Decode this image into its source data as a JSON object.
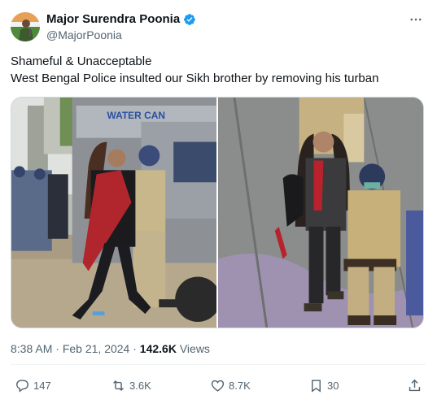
{
  "author": {
    "name": "Major Surendra Poonia",
    "handle": "@MajorPoonia",
    "verified": true
  },
  "tweet": {
    "lines": [
      "Shameful & Unacceptable",
      "West Bengal Police insulted our Sikh brother by removing his turban"
    ]
  },
  "media": {
    "images": [
      {
        "icon": "photo-police-vehicle-scene",
        "vehicle_text": "WATER CAN"
      },
      {
        "icon": "photo-police-escort-scene"
      }
    ]
  },
  "meta": {
    "time": "8:38 AM",
    "separator": "·",
    "date": "Feb 21, 2024",
    "views_count": "142.6K",
    "views_label": "Views"
  },
  "actions": {
    "replies": "147",
    "reposts": "3.6K",
    "likes": "8.7K",
    "bookmarks": "30"
  },
  "colors": {
    "verified": "#1d9bf0",
    "secondary_text": "#536471",
    "primary_text": "#0f1419",
    "border": "#cfd9de"
  }
}
